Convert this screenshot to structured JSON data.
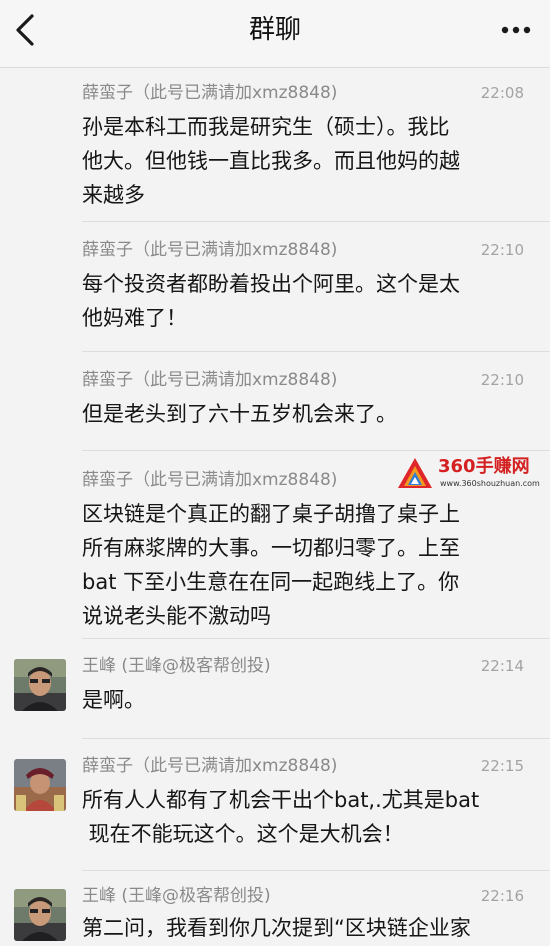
{
  "header": {
    "title": "群聊",
    "back_icon": "chevron-left-icon",
    "more_icon": "ellipsis-icon"
  },
  "messages": [
    {
      "sender": "薛蛮子（此号已满请加xmz8848)",
      "time": "22:08",
      "lines": [
        "孙是本科工而我是研究生（硕士）。我比",
        "他大。但他钱一直比我多。而且他妈的越",
        "来越多"
      ]
    },
    {
      "sender": "薛蛮子（此号已满请加xmz8848)",
      "time": "22:10",
      "lines": [
        "每个投资者都盼着投出个阿里。这个是太",
        "他妈难了！"
      ]
    },
    {
      "sender": "薛蛮子（此号已满请加xmz8848)",
      "time": "22:10",
      "lines": [
        "但是老头到了六十五岁机会来了。"
      ]
    },
    {
      "sender": "薛蛮子（此号已满请加xmz8848)",
      "time": "",
      "lines": [
        "区块链是个真正的翻了桌子胡撸了桌子上",
        "所有麻浆牌的大事。一切都归零了。上至",
        "bat 下至小生意在在同一起跑线上了。你",
        "说说老头能不激动吗"
      ]
    },
    {
      "sender": "王峰 (王峰@极客帮创投)",
      "time": "22:14",
      "lines": [
        "是啊。"
      ]
    },
    {
      "sender": "薛蛮子（此号已满请加xmz8848)",
      "time": "22:15",
      "lines": [
        "所有人人都有了机会干出个bat,.尤其是bat",
        " 现在不能玩这个。这个是大机会！"
      ]
    },
    {
      "sender": "王峰 (王峰@极客帮创投)",
      "time": "22:16",
      "lines": [
        "第二问，我看到你几次提到“区块链企业家"
      ]
    }
  ],
  "watermark": {
    "title": "360手赚网",
    "url": "www.360shouzhuan.com"
  },
  "colors": {
    "background": "#f3f3f3",
    "meta_text": "#8a8a8a",
    "watermark_red": "#d42020"
  }
}
